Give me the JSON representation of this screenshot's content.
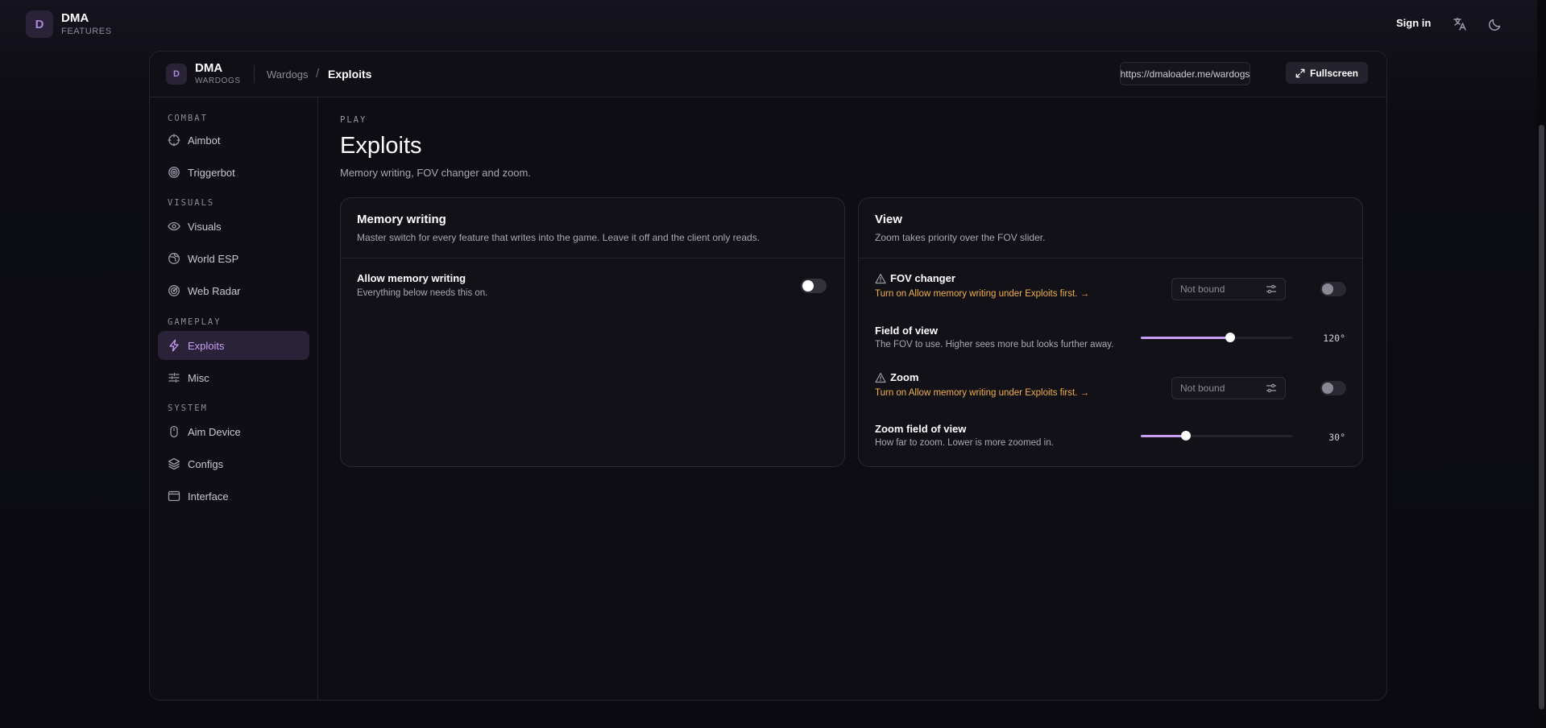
{
  "app": {
    "badge_letter": "D",
    "title": "DMA",
    "subtitle": "FEATURES"
  },
  "topbar": {
    "signin_label": "Sign in"
  },
  "frame": {
    "badge_letter": "D",
    "title": "DMA",
    "subtitle": "WARDOGS",
    "breadcrumb": [
      "Wardogs",
      "Exploits"
    ],
    "breadcrumb_separator": "/",
    "url": "https://dmaloader.me/wardogs",
    "fullscreen_label": "Fullscreen"
  },
  "sidebar": {
    "sections": [
      {
        "label": "COMBAT",
        "items": [
          {
            "label": "Aimbot",
            "icon": "crosshair-icon"
          },
          {
            "label": "Triggerbot",
            "icon": "target-icon"
          }
        ]
      },
      {
        "label": "VISUALS",
        "items": [
          {
            "label": "Visuals",
            "icon": "eye-icon"
          },
          {
            "label": "World ESP",
            "icon": "globe-icon"
          },
          {
            "label": "Web Radar",
            "icon": "radar-icon"
          }
        ]
      },
      {
        "label": "GAMEPLAY",
        "items": [
          {
            "label": "Exploits",
            "icon": "bolt-icon",
            "active": true
          },
          {
            "label": "Misc",
            "icon": "sliders-icon"
          }
        ]
      },
      {
        "label": "SYSTEM",
        "items": [
          {
            "label": "Aim Device",
            "icon": "mouse-icon"
          },
          {
            "label": "Configs",
            "icon": "layers-icon"
          },
          {
            "label": "Interface",
            "icon": "window-icon"
          }
        ]
      }
    ]
  },
  "page": {
    "eyebrow": "PLAY",
    "title": "Exploits",
    "description": "Memory writing, FOV changer and zoom."
  },
  "memory_card": {
    "title": "Memory writing",
    "description": "Master switch for every feature that writes into the game. Leave it off and the client only reads.",
    "allow": {
      "title": "Allow memory writing",
      "subtitle": "Everything below needs this on.",
      "enabled": false
    }
  },
  "view_card": {
    "title": "View",
    "description": "Zoom takes priority over the FOV slider.",
    "fov_changer": {
      "title": "FOV changer",
      "warning": "Turn on Allow memory writing under Exploits first. →",
      "bind_label": "Not bound",
      "enabled": false
    },
    "field_of_view": {
      "title": "Field of view",
      "subtitle": "The FOV to use. Higher sees more but looks further away.",
      "value_label": "120°",
      "fraction": 0.59
    },
    "zoom": {
      "title": "Zoom",
      "warning": "Turn on Allow memory writing under Exploits first. →",
      "bind_label": "Not bound",
      "enabled": false
    },
    "zoom_fov": {
      "title": "Zoom field of view",
      "subtitle": "How far to zoom. Lower is more zoomed in.",
      "value_label": "30°",
      "fraction": 0.3
    }
  },
  "colors": {
    "accent": "#c79ff2",
    "warning": "#f0b04a",
    "background": "#0c0b12"
  }
}
